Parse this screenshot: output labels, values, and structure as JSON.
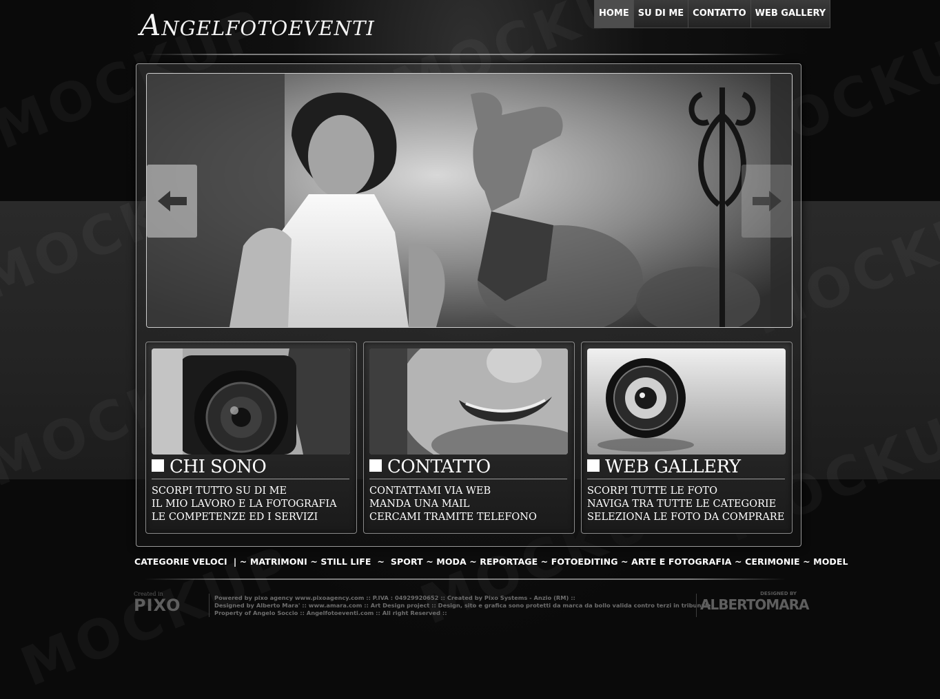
{
  "site": {
    "logo": "Angelfotoeventi"
  },
  "watermark": "MOCKUP",
  "nav": {
    "items": [
      {
        "label": "HOME",
        "active": true
      },
      {
        "label": "SU DI ME",
        "active": false
      },
      {
        "label": "CONTATTO",
        "active": false
      },
      {
        "label": "WEB GALLERY",
        "active": false
      }
    ]
  },
  "slider": {
    "prev_icon": "arrow-left-icon",
    "next_icon": "arrow-right-icon"
  },
  "cards": [
    {
      "title": "CHI SONO",
      "photo": "camera-photographer-photo",
      "lines": [
        "SCORPI TUTTO SU DI ME",
        "IL MIO LAVORO E LA FOTOGRAFIA",
        "LE COMPETENZE ED I SERVIZI"
      ]
    },
    {
      "title": "CONTATTO",
      "photo": "smiling-face-photo",
      "lines": [
        "CONTATTAMI VIA WEB",
        "MANDA UNA MAIL",
        "CERCAMI TRAMITE TELEFONO"
      ]
    },
    {
      "title": "WEB GALLERY",
      "photo": "camera-lens-photo",
      "lines": [
        "SCORPI TUTTE LE FOTO",
        "NAVIGA TRA TUTTE LE CATEGORIE",
        "SELEZIONA LE FOTO DA COMPRARE"
      ]
    }
  ],
  "quick_categories": {
    "label": "CATEGORIE VELOCI",
    "separator": "|",
    "items": [
      "MATRIMONI",
      "STILL LIFE",
      "SPORT",
      "MODA",
      "REPORTAGE",
      "FOTOEDITING",
      "ARTE E FOTOGRAFIA",
      "CERIMONIE",
      "MODEL"
    ]
  },
  "footer": {
    "pixo_caption": "Created in",
    "pixo_logo": "PIXO",
    "lines": [
      "Powered by pixo agency  www.pixoagency.com :: P.IVA : 04929920652 :: Created by Pixo Systems - Anzio (RM) ::",
      "Designed by Alberto Mara' :: www.amara.com :: Art Design project :: Design, sito e grafica sono protetti da marca da bollo valida contro terzi in tribunale",
      "Property of Angelo Soccio :: Angelfotoeventi.com :: All right Reserved ::"
    ],
    "designer_caption": "DESIGNED BY",
    "designer_logo": "ALBERTOMARA"
  },
  "colors": {
    "background": "#0a0a0a",
    "band": "#262626",
    "text": "#ffffff",
    "footer_text": "#6d6d6d"
  }
}
